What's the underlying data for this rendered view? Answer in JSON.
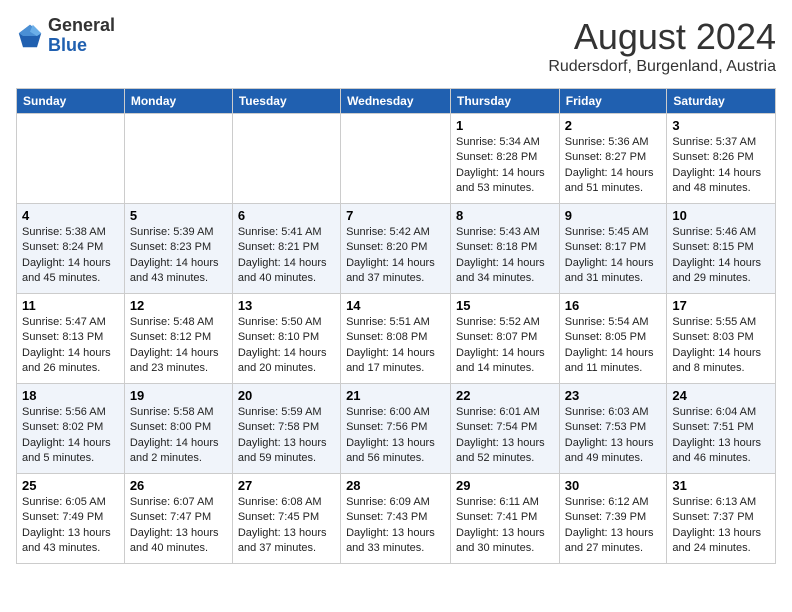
{
  "header": {
    "logo_general": "General",
    "logo_blue": "Blue",
    "title": "August 2024",
    "subtitle": "Rudersdorf, Burgenland, Austria"
  },
  "weekdays": [
    "Sunday",
    "Monday",
    "Tuesday",
    "Wednesday",
    "Thursday",
    "Friday",
    "Saturday"
  ],
  "weeks": [
    [
      {
        "day": "",
        "info": ""
      },
      {
        "day": "",
        "info": ""
      },
      {
        "day": "",
        "info": ""
      },
      {
        "day": "",
        "info": ""
      },
      {
        "day": "1",
        "info": "Sunrise: 5:34 AM\nSunset: 8:28 PM\nDaylight: 14 hours\nand 53 minutes."
      },
      {
        "day": "2",
        "info": "Sunrise: 5:36 AM\nSunset: 8:27 PM\nDaylight: 14 hours\nand 51 minutes."
      },
      {
        "day": "3",
        "info": "Sunrise: 5:37 AM\nSunset: 8:26 PM\nDaylight: 14 hours\nand 48 minutes."
      }
    ],
    [
      {
        "day": "4",
        "info": "Sunrise: 5:38 AM\nSunset: 8:24 PM\nDaylight: 14 hours\nand 45 minutes."
      },
      {
        "day": "5",
        "info": "Sunrise: 5:39 AM\nSunset: 8:23 PM\nDaylight: 14 hours\nand 43 minutes."
      },
      {
        "day": "6",
        "info": "Sunrise: 5:41 AM\nSunset: 8:21 PM\nDaylight: 14 hours\nand 40 minutes."
      },
      {
        "day": "7",
        "info": "Sunrise: 5:42 AM\nSunset: 8:20 PM\nDaylight: 14 hours\nand 37 minutes."
      },
      {
        "day": "8",
        "info": "Sunrise: 5:43 AM\nSunset: 8:18 PM\nDaylight: 14 hours\nand 34 minutes."
      },
      {
        "day": "9",
        "info": "Sunrise: 5:45 AM\nSunset: 8:17 PM\nDaylight: 14 hours\nand 31 minutes."
      },
      {
        "day": "10",
        "info": "Sunrise: 5:46 AM\nSunset: 8:15 PM\nDaylight: 14 hours\nand 29 minutes."
      }
    ],
    [
      {
        "day": "11",
        "info": "Sunrise: 5:47 AM\nSunset: 8:13 PM\nDaylight: 14 hours\nand 26 minutes."
      },
      {
        "day": "12",
        "info": "Sunrise: 5:48 AM\nSunset: 8:12 PM\nDaylight: 14 hours\nand 23 minutes."
      },
      {
        "day": "13",
        "info": "Sunrise: 5:50 AM\nSunset: 8:10 PM\nDaylight: 14 hours\nand 20 minutes."
      },
      {
        "day": "14",
        "info": "Sunrise: 5:51 AM\nSunset: 8:08 PM\nDaylight: 14 hours\nand 17 minutes."
      },
      {
        "day": "15",
        "info": "Sunrise: 5:52 AM\nSunset: 8:07 PM\nDaylight: 14 hours\nand 14 minutes."
      },
      {
        "day": "16",
        "info": "Sunrise: 5:54 AM\nSunset: 8:05 PM\nDaylight: 14 hours\nand 11 minutes."
      },
      {
        "day": "17",
        "info": "Sunrise: 5:55 AM\nSunset: 8:03 PM\nDaylight: 14 hours\nand 8 minutes."
      }
    ],
    [
      {
        "day": "18",
        "info": "Sunrise: 5:56 AM\nSunset: 8:02 PM\nDaylight: 14 hours\nand 5 minutes."
      },
      {
        "day": "19",
        "info": "Sunrise: 5:58 AM\nSunset: 8:00 PM\nDaylight: 14 hours\nand 2 minutes."
      },
      {
        "day": "20",
        "info": "Sunrise: 5:59 AM\nSunset: 7:58 PM\nDaylight: 13 hours\nand 59 minutes."
      },
      {
        "day": "21",
        "info": "Sunrise: 6:00 AM\nSunset: 7:56 PM\nDaylight: 13 hours\nand 56 minutes."
      },
      {
        "day": "22",
        "info": "Sunrise: 6:01 AM\nSunset: 7:54 PM\nDaylight: 13 hours\nand 52 minutes."
      },
      {
        "day": "23",
        "info": "Sunrise: 6:03 AM\nSunset: 7:53 PM\nDaylight: 13 hours\nand 49 minutes."
      },
      {
        "day": "24",
        "info": "Sunrise: 6:04 AM\nSunset: 7:51 PM\nDaylight: 13 hours\nand 46 minutes."
      }
    ],
    [
      {
        "day": "25",
        "info": "Sunrise: 6:05 AM\nSunset: 7:49 PM\nDaylight: 13 hours\nand 43 minutes."
      },
      {
        "day": "26",
        "info": "Sunrise: 6:07 AM\nSunset: 7:47 PM\nDaylight: 13 hours\nand 40 minutes."
      },
      {
        "day": "27",
        "info": "Sunrise: 6:08 AM\nSunset: 7:45 PM\nDaylight: 13 hours\nand 37 minutes."
      },
      {
        "day": "28",
        "info": "Sunrise: 6:09 AM\nSunset: 7:43 PM\nDaylight: 13 hours\nand 33 minutes."
      },
      {
        "day": "29",
        "info": "Sunrise: 6:11 AM\nSunset: 7:41 PM\nDaylight: 13 hours\nand 30 minutes."
      },
      {
        "day": "30",
        "info": "Sunrise: 6:12 AM\nSunset: 7:39 PM\nDaylight: 13 hours\nand 27 minutes."
      },
      {
        "day": "31",
        "info": "Sunrise: 6:13 AM\nSunset: 7:37 PM\nDaylight: 13 hours\nand 24 minutes."
      }
    ]
  ]
}
